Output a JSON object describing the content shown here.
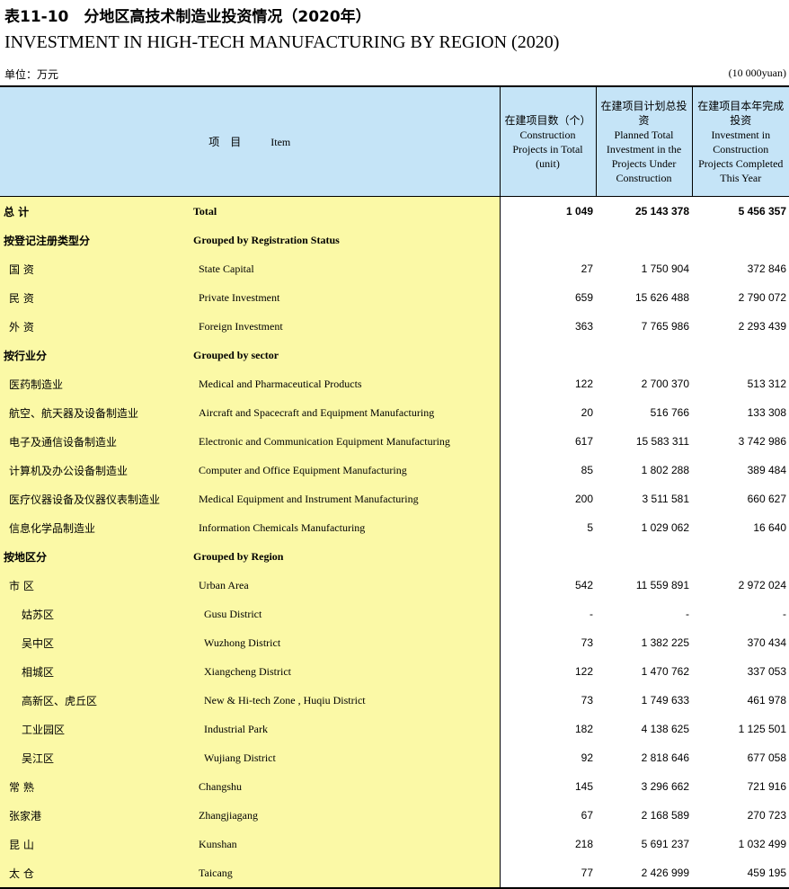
{
  "title_cn": "表11-10　分地区高技术制造业投资情况（2020年）",
  "title_en": "INVESTMENT IN HIGH-TECH MANUFACTURING BY REGION (2020)",
  "unit_cn": "单位：万元",
  "unit_en": "(10 000yuan)",
  "header": {
    "item_cn": "项　目",
    "item_en": "Item",
    "col1_cn": "在建项目数（个）",
    "col1_en": "Construction Projects in Total (unit)",
    "col2_cn": "在建项目计划总投资",
    "col2_en": "Planned Total Investment in the Projects Under Construction",
    "col3_cn": "在建项目本年完成投资",
    "col3_en": "Investment in Construction Projects Completed This Year"
  },
  "rows": [
    {
      "cn": "总  计",
      "en": "Total",
      "v1": "1 049",
      "v2": "25 143 378",
      "v3": "5 456 357",
      "bold": true,
      "level": 0
    },
    {
      "cn": "按登记注册类型分",
      "en": "Grouped by Registration Status",
      "v1": "",
      "v2": "",
      "v3": "",
      "bold": true,
      "level": 0
    },
    {
      "cn": "国  资",
      "en": "State Capital",
      "v1": "27",
      "v2": "1 750 904",
      "v3": "372 846",
      "bold": false,
      "level": 1
    },
    {
      "cn": "民  资",
      "en": "Private Investment",
      "v1": "659",
      "v2": "15 626 488",
      "v3": "2 790 072",
      "bold": false,
      "level": 1
    },
    {
      "cn": "外  资",
      "en": "Foreign Investment",
      "v1": "363",
      "v2": "7 765 986",
      "v3": "2 293 439",
      "bold": false,
      "level": 1
    },
    {
      "cn": "按行业分",
      "en": "Grouped by sector",
      "v1": "",
      "v2": "",
      "v3": "",
      "bold": true,
      "level": 0
    },
    {
      "cn": "医药制造业",
      "en": "Medical and Pharmaceutical Products",
      "v1": "122",
      "v2": "2 700 370",
      "v3": "513 312",
      "bold": false,
      "level": 1
    },
    {
      "cn": "航空、航天器及设备制造业",
      "en": "Aircraft and Spacecraft and Equipment Manufacturing",
      "v1": "20",
      "v2": "516 766",
      "v3": "133 308",
      "bold": false,
      "level": 1
    },
    {
      "cn": "电子及通信设备制造业",
      "en": "Electronic and Communication Equipment Manufacturing",
      "v1": "617",
      "v2": "15 583 311",
      "v3": "3 742 986",
      "bold": false,
      "level": 1
    },
    {
      "cn": "计算机及办公设备制造业",
      "en": "Computer and Office Equipment Manufacturing",
      "v1": "85",
      "v2": "1 802 288",
      "v3": "389 484",
      "bold": false,
      "level": 1
    },
    {
      "cn": "医疗仪器设备及仪器仪表制造业",
      "en": "Medical Equipment and Instrument Manufacturing",
      "v1": "200",
      "v2": "3 511 581",
      "v3": "660 627",
      "bold": false,
      "level": 1
    },
    {
      "cn": "信息化学品制造业",
      "en": "Information Chemicals Manufacturing",
      "v1": "5",
      "v2": "1 029 062",
      "v3": "16 640",
      "bold": false,
      "level": 1
    },
    {
      "cn": "按地区分",
      "en": "Grouped by Region",
      "v1": "",
      "v2": "",
      "v3": "",
      "bold": true,
      "level": 0
    },
    {
      "cn": "市  区",
      "en": "Urban Area",
      "v1": "542",
      "v2": "11 559 891",
      "v3": "2 972 024",
      "bold": false,
      "level": 1
    },
    {
      "cn": "姑苏区",
      "en": "Gusu  District",
      "v1": "-",
      "v2": "-",
      "v3": "-",
      "bold": false,
      "level": 2
    },
    {
      "cn": "吴中区",
      "en": "Wuzhong District",
      "v1": "73",
      "v2": "1 382 225",
      "v3": "370 434",
      "bold": false,
      "level": 2
    },
    {
      "cn": "相城区",
      "en": "Xiangcheng District",
      "v1": "122",
      "v2": "1 470 762",
      "v3": "337 053",
      "bold": false,
      "level": 2
    },
    {
      "cn": "高新区、虎丘区",
      "en": "New & Hi-tech Zone , Huqiu District",
      "v1": "73",
      "v2": "1 749 633",
      "v3": "461 978",
      "bold": false,
      "level": 2
    },
    {
      "cn": "工业园区",
      "en": "Industrial Park",
      "v1": "182",
      "v2": "4 138 625",
      "v3": "1 125 501",
      "bold": false,
      "level": 2
    },
    {
      "cn": "吴江区",
      "en": "Wujiang District",
      "v1": "92",
      "v2": "2 818 646",
      "v3": "677 058",
      "bold": false,
      "level": 2
    },
    {
      "cn": "常  熟",
      "en": "Changshu",
      "v1": "145",
      "v2": "3 296 662",
      "v3": "721 916",
      "bold": false,
      "level": 1
    },
    {
      "cn": "张家港",
      "en": "Zhangjiagang",
      "v1": "67",
      "v2": "2 168 589",
      "v3": "270 723",
      "bold": false,
      "level": 1
    },
    {
      "cn": "昆  山",
      "en": "Kunshan",
      "v1": "218",
      "v2": "5 691 237",
      "v3": "1 032 499",
      "bold": false,
      "level": 1
    },
    {
      "cn": "太  仓",
      "en": "Taicang",
      "v1": "77",
      "v2": "2 426 999",
      "v3": "459 195",
      "bold": false,
      "level": 1
    }
  ]
}
